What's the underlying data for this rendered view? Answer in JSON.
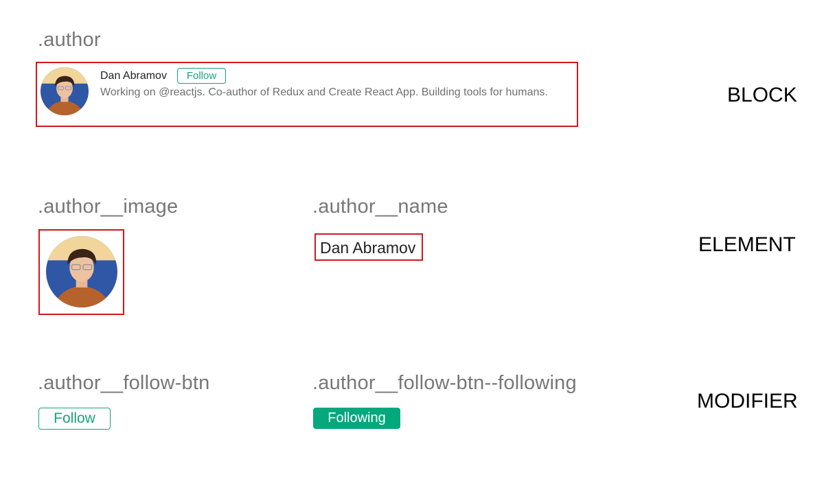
{
  "colors": {
    "outline_red": "#d0181e",
    "label_gray": "#777777",
    "follow_green": "#1aa27a",
    "following_green": "#03a87c"
  },
  "block": {
    "class_label": ".author",
    "tier_label": "BLOCK",
    "card": {
      "name": "Dan Abramov",
      "follow_label": "Follow",
      "bio": "Working on @reactjs. Co-author of Redux and Create React App. Building tools for humans."
    }
  },
  "element": {
    "tier_label": "ELEMENT",
    "image_class_label": ".author__image",
    "name_class_label": ".author__name",
    "name_value": "Dan Abramov"
  },
  "modifier": {
    "tier_label": "MODIFIER",
    "follow_class_label": ".author__follow-btn",
    "following_class_label": ".author__follow-btn--following",
    "follow_label": "Follow",
    "following_label": "Following"
  }
}
